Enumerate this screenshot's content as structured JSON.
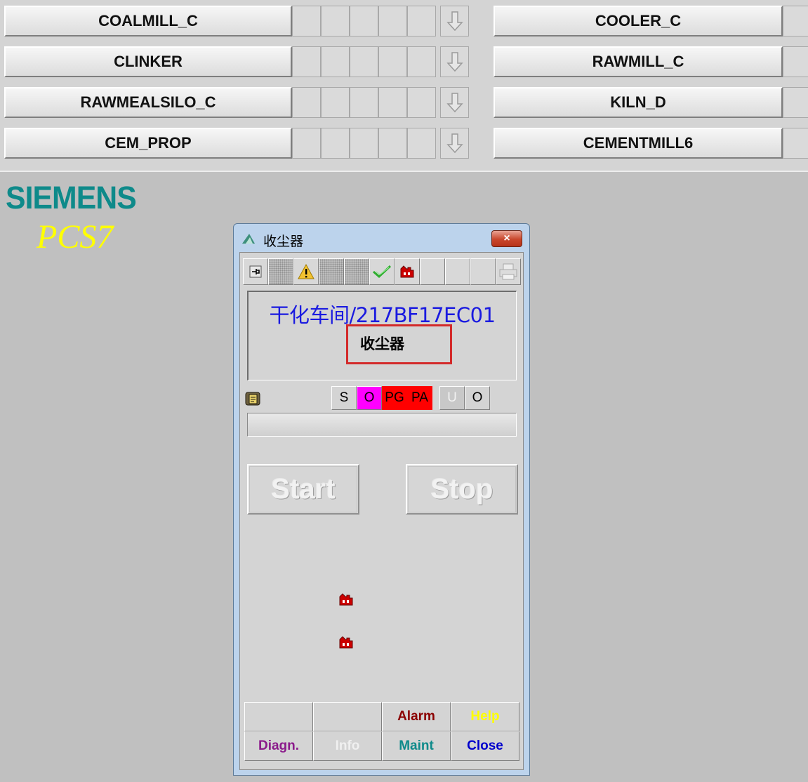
{
  "nav": {
    "left": [
      "COALMILL_C",
      "CLINKER",
      "RAWMEALSILO_C",
      "CEM_PROP"
    ],
    "right": [
      "COOLER_C",
      "RAWMILL_C",
      "KILN_D",
      "CEMENTMILL6"
    ]
  },
  "logo": {
    "brand": "SIEMENS",
    "product": "PCS7"
  },
  "faceplate": {
    "title": "收尘器",
    "close_symbol": "×",
    "tag_path": "干化车间/217BF17EC01",
    "tag_name": "收尘器",
    "flags": [
      "S",
      "O",
      "PG",
      "PA",
      "U",
      "O"
    ],
    "start_label": "Start",
    "stop_label": "Stop",
    "buttons": {
      "alarm": "Alarm",
      "help": "Help",
      "diagn": "Diagn.",
      "info": "Info",
      "maint": "Maint",
      "close": "Close"
    }
  },
  "colors": {
    "tag_path": "#1a1ae0",
    "highlight_box": "#d32a2a",
    "flag_o": "#ff00ff",
    "flag_pg": "#ff0000",
    "flag_pa": "#ff0000",
    "alarm": "#8b0000",
    "help": "#ffff00",
    "diagn": "#8b1a8b",
    "info": "#f0f0f0",
    "maint": "#0e8a8a",
    "close": "#0000cc",
    "logo": "#0e8a8a",
    "pcs7": "#ffff00"
  },
  "icons": [
    "down-arrow-icon",
    "faceplate-title-icon",
    "pin-icon",
    "warning-icon",
    "checkmark-icon",
    "factory-icon",
    "print-icon",
    "status-memo-icon"
  ]
}
